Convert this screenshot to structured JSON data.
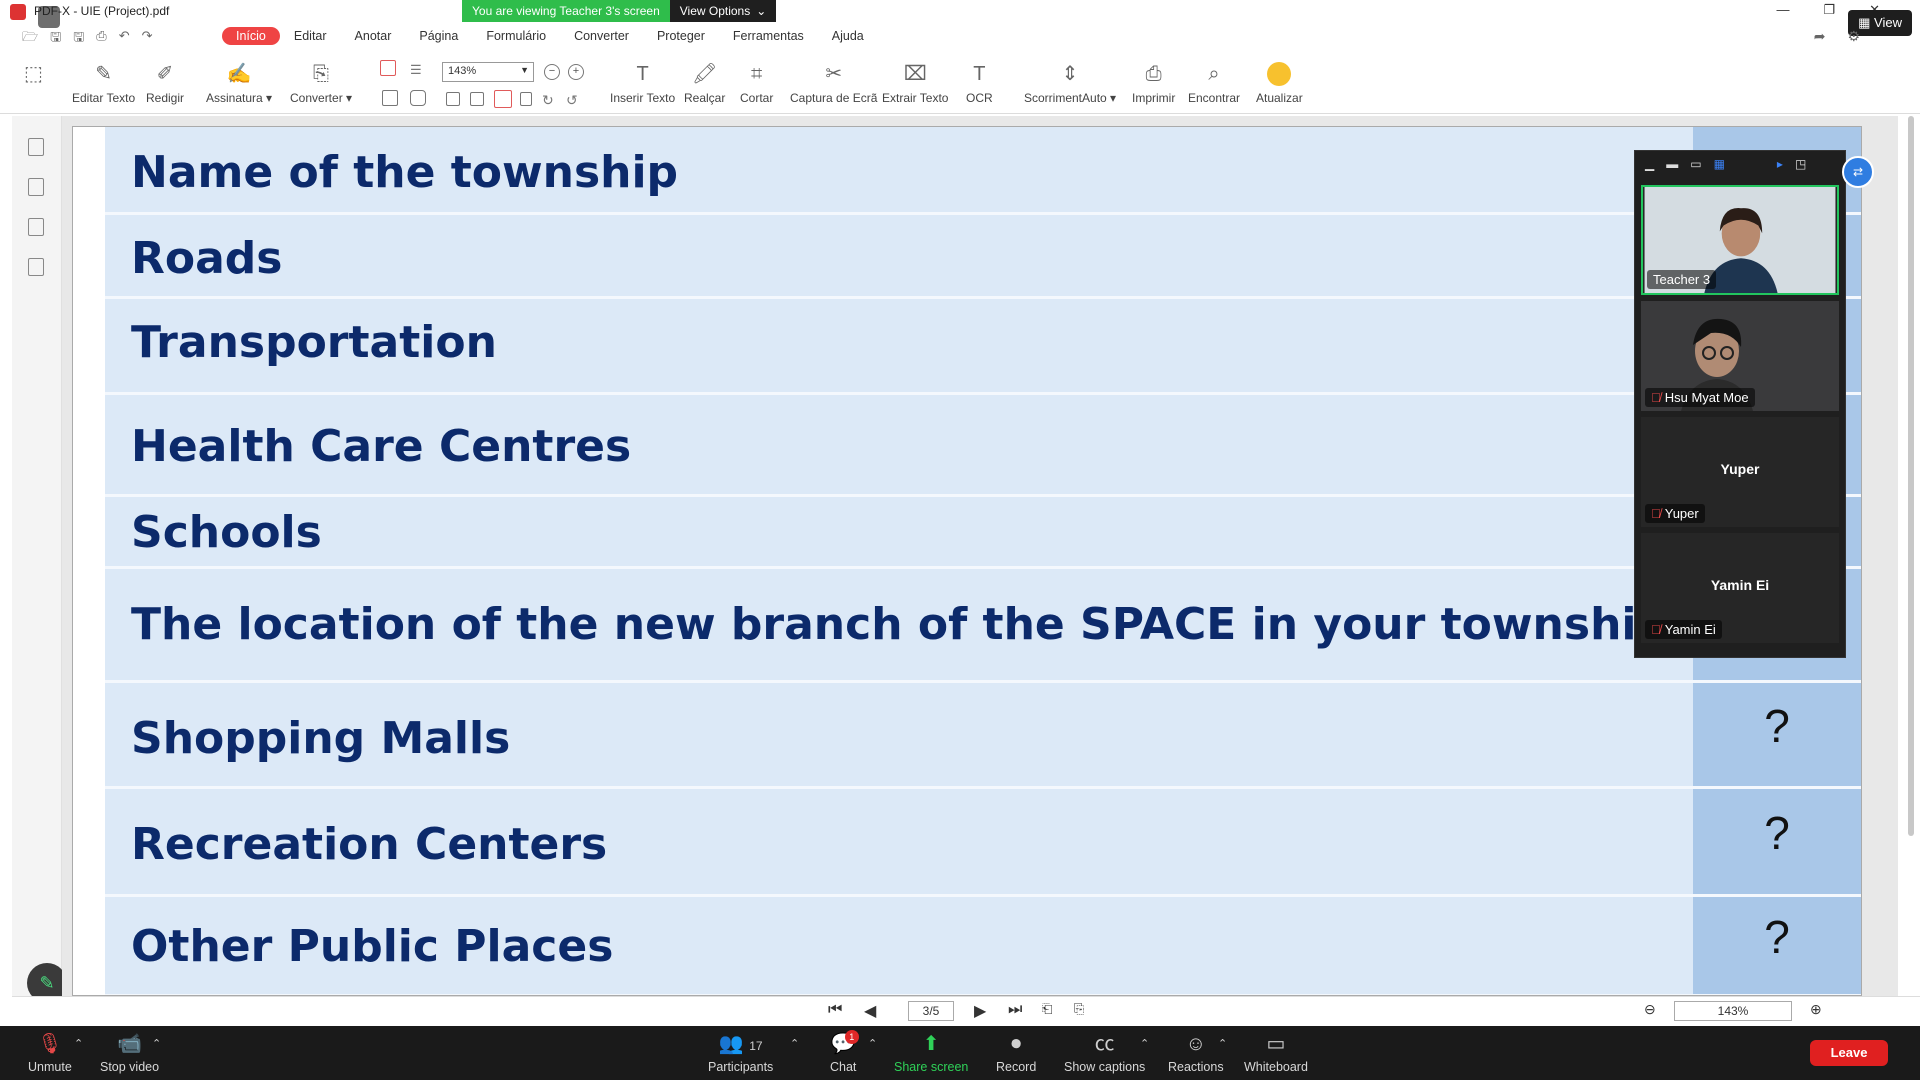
{
  "window": {
    "title": "PDF-XChange - UIE (Project).pdf",
    "title_visible": "PDF-X - UIE (Project).pdf"
  },
  "share_banner": {
    "message": "You are viewing Teacher 3's screen",
    "view_options": "View Options"
  },
  "view_button": "View",
  "menu": [
    "Início",
    "Editar",
    "Anotar",
    "Página",
    "Formulário",
    "Converter",
    "Proteger",
    "Ferramentas",
    "Ajuda"
  ],
  "toolbar": {
    "editar_texto": "Editar Texto",
    "redigir": "Redigir",
    "assinatura": "Assinatura",
    "converter": "Converter",
    "zoom": "143%",
    "inserir_texto": "Inserir Texto",
    "realcar": "Realçar",
    "cortar": "Cortar",
    "captura": "Captura de Ecrã",
    "extrair": "Extrair Texto",
    "ocr": "OCR",
    "scroll": "ScorrimentAuto",
    "imprimir": "Imprimir",
    "encontrar": "Encontrar",
    "atualizar": "Atualizar"
  },
  "document": {
    "rows": [
      {
        "text": "Name of the township",
        "q": ""
      },
      {
        "text": "Roads",
        "q": ""
      },
      {
        "text": "Transportation",
        "q": ""
      },
      {
        "text": "Health Care Centres",
        "q": ""
      },
      {
        "text": "Schools",
        "q": ""
      },
      {
        "text": "The location of the new branch of the SPACE in  your township",
        "q": ""
      },
      {
        "text": "Shopping Malls",
        "q": "?"
      },
      {
        "text": "Recreation Centers",
        "q": "?"
      },
      {
        "text": "Other Public Places",
        "q": "?"
      }
    ]
  },
  "pdf_nav": {
    "page": "3/5",
    "zoom": "143%"
  },
  "participants_panel": [
    {
      "name": "Teacher 3",
      "active": true,
      "muted": false,
      "center": ""
    },
    {
      "name": "Hsu Myat Moe",
      "active": false,
      "muted": true,
      "center": ""
    },
    {
      "name": "Yuper",
      "active": false,
      "muted": true,
      "center": "Yuper"
    },
    {
      "name": "Yamin Ei",
      "active": false,
      "muted": true,
      "center": "Yamin Ei"
    }
  ],
  "meeting_bar": {
    "unmute": "Unmute",
    "stop_video": "Stop video",
    "participants": "Participants",
    "participants_count": "17",
    "chat": "Chat",
    "chat_badge": "1",
    "share_screen": "Share screen",
    "record": "Record",
    "show_captions": "Show captions",
    "reactions": "Reactions",
    "whiteboard": "Whiteboard",
    "leave": "Leave"
  },
  "colors": {
    "row_bg": "#dce9f7",
    "q_bg": "#a9c7e8",
    "text": "#0c2a6b",
    "leave": "#e02020",
    "share_green": "#2fd158"
  }
}
